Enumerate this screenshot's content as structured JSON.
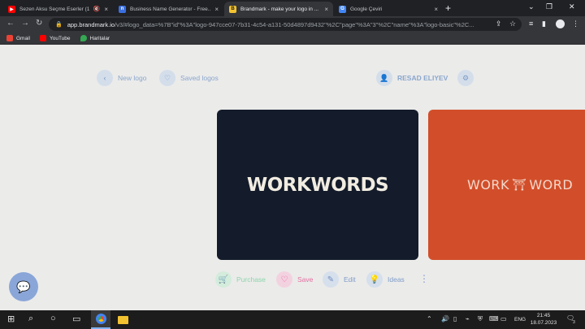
{
  "tabs": [
    {
      "title": "Sezen Aksu Seçme Eserler (1...",
      "favicon": "youtube-icon",
      "color": "#ff0000",
      "muted": true
    },
    {
      "title": "Business Name Generator - Free...",
      "favicon": "bng-icon",
      "color": "#3b6fe0",
      "muted": false
    },
    {
      "title": "Brandmark - make your logo in ...",
      "favicon": "brandmark-icon",
      "color": "#f2c230",
      "muted": false
    },
    {
      "title": "Google Çeviri",
      "favicon": "translate-icon",
      "color": "#4285f4",
      "muted": false
    }
  ],
  "address": {
    "host": "app.brandmark.io",
    "path": "/v3/#logo_data=%7B\"id\"%3A\"logo-947cce07-7b31-4c54-a131-50d4897d9432\"%2C\"page\"%3A\"3\"%2C\"name\"%3A\"logo-basic\"%2C..."
  },
  "bookmarks": [
    {
      "label": "Gmail",
      "icon": "gmail-icon",
      "color": "#ea4335"
    },
    {
      "label": "YouTube",
      "icon": "youtube-icon",
      "color": "#ff0000"
    },
    {
      "label": "Haritalar",
      "icon": "maps-icon",
      "color": "#34a853"
    }
  ],
  "topnav": {
    "new_logo": "New logo",
    "saved_logos": "Saved logos",
    "user_name": "RESAD ELIYEV"
  },
  "logos": {
    "primary": {
      "pre": "WORK",
      "post": "WORDS",
      "bg": "#141c2b",
      "fg": "#f1ece1"
    },
    "secondary": {
      "pre": "WORK",
      "post": "WORD",
      "bg": "#d24e2a",
      "fg": "#f3d9cc"
    }
  },
  "actions": {
    "purchase": "Purchase",
    "save": "Save",
    "edit": "Edit",
    "ideas": "Ideas"
  },
  "taskbar": {
    "language": "ENG",
    "time": "21:45",
    "date": "18.07.2023",
    "notifications": "3"
  }
}
